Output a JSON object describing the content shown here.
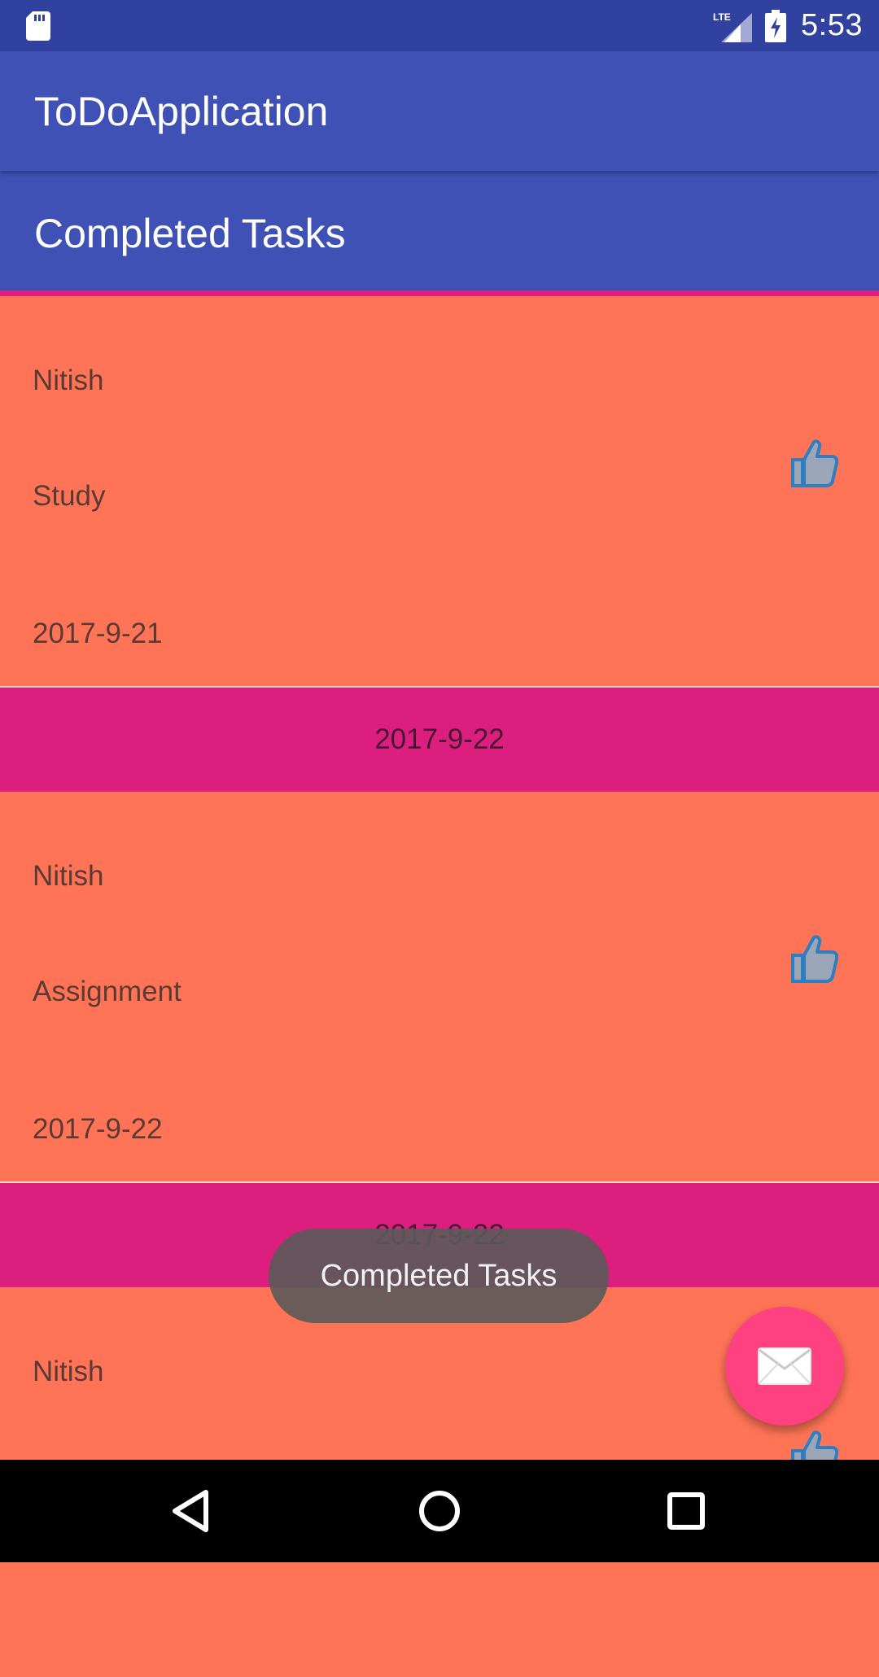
{
  "status_bar": {
    "time": "5:53",
    "network_label": "LTE",
    "icons": [
      "sd-card-icon",
      "lte-signal-icon",
      "battery-charging-icon"
    ]
  },
  "app_bar": {
    "title": "ToDoApplication"
  },
  "section": {
    "title": "Completed Tasks"
  },
  "tasks": [
    {
      "name": "Nitish",
      "task": "Study",
      "date": "2017-9-21",
      "icon": "thumbs-up-icon"
    },
    {
      "group_date": "2017-9-22"
    },
    {
      "name": "Nitish",
      "task": "Assignment",
      "date": "2017-9-22",
      "icon": "thumbs-up-icon"
    },
    {
      "group_date": "2017-9-22"
    },
    {
      "name": "Nitish",
      "icon": "thumbs-up-icon"
    }
  ],
  "toast": {
    "text": "Completed Tasks"
  },
  "fab": {
    "icon": "mail-icon",
    "color": "#ff4081"
  },
  "nav_bar": {
    "icons": [
      "back-icon",
      "home-icon",
      "recents-icon"
    ]
  },
  "colors": {
    "primary": "#3f51b5",
    "primary_dark": "#3041a0",
    "card": "#ff7456",
    "date_header": "#dc1f7e",
    "accent": "#ff4081"
  }
}
